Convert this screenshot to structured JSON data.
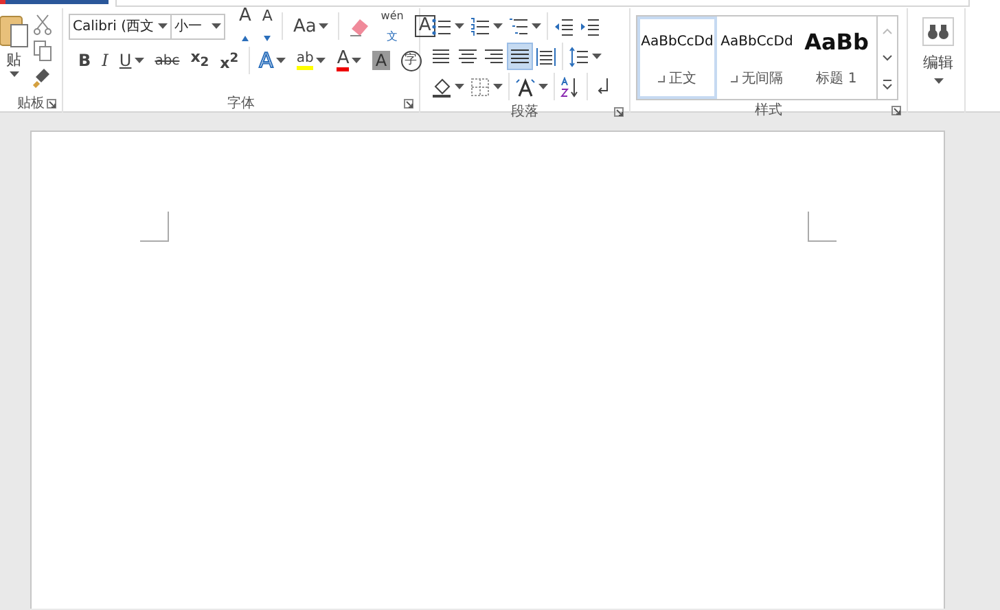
{
  "clipboard": {
    "paste_label": "贴",
    "group_label": "贴板",
    "launcher": true
  },
  "font": {
    "font_name": "Calibri (西文",
    "font_size": "小一",
    "group_label": "字体",
    "launcher": true,
    "row1": [
      [
        {
          "kind": "grow",
          "label": "A",
          "dropdown": false
        },
        {
          "kind": "shrink",
          "label": "A",
          "dropdown": false
        }
      ],
      [
        {
          "kind": "case",
          "label": "Aa",
          "dropdown": true
        }
      ],
      [
        {
          "kind": "eraser",
          "dropdown": false
        },
        {
          "kind": "phonetic",
          "label": "wén",
          "sub": "文",
          "dropdown": false
        },
        {
          "kind": "boxed",
          "label": "A",
          "dropdown": false
        }
      ]
    ],
    "row2": [
      [
        {
          "kind": "bold",
          "label": "B",
          "dropdown": false
        },
        {
          "kind": "italic",
          "label": "I",
          "dropdown": false
        },
        {
          "kind": "underline",
          "label": "U",
          "dropdown": true
        },
        {
          "kind": "strike",
          "label": "abc",
          "dropdown": false
        },
        {
          "kind": "sub",
          "label": "x$_{2}$",
          "dropdown": false
        },
        {
          "kind": "sup",
          "label": "x$^{2}$",
          "dropdown": false
        }
      ],
      [
        {
          "kind": "effect",
          "label": "A",
          "dropdown": true
        },
        {
          "kind": "highlight",
          "label": "ab",
          "dropdown": true
        },
        {
          "kind": "color",
          "label": "A",
          "dropdown": true
        },
        {
          "kind": "shaded",
          "label": "A",
          "dropdown": false
        },
        {
          "kind": "enclosed",
          "label": "字",
          "dropdown": false
        }
      ]
    ]
  },
  "paragraph": {
    "group_label": "段落",
    "launcher": true,
    "rows": [
      [
        [
          {
            "kind": "bullets",
            "dropdown": true,
            "selected": false
          },
          {
            "kind": "numbering",
            "dropdown": true,
            "selected": false
          },
          {
            "kind": "multilevel",
            "dropdown": true,
            "selected": false
          }
        ],
        [
          {
            "kind": "outdent",
            "dropdown": false,
            "selected": false
          },
          {
            "kind": "indent",
            "dropdown": false,
            "selected": false
          }
        ]
      ],
      [
        [
          {
            "kind": "align-left",
            "dropdown": false,
            "selected": false
          },
          {
            "kind": "align-center",
            "dropdown": false,
            "selected": false
          },
          {
            "kind": "align-right",
            "dropdown": false,
            "selected": false
          },
          {
            "kind": "justify",
            "dropdown": false,
            "selected": true
          },
          {
            "kind": "distributed",
            "dropdown": false,
            "selected": false
          }
        ],
        [
          {
            "kind": "line-spacing",
            "dropdown": true,
            "selected": false
          }
        ]
      ],
      [
        [
          {
            "kind": "shading",
            "dropdown": true,
            "selected": false
          },
          {
            "kind": "borders",
            "dropdown": true,
            "selected": false
          }
        ],
        [
          {
            "kind": "asian-layout",
            "dropdown": true,
            "selected": false
          }
        ],
        [
          {
            "kind": "sort",
            "dropdown": false,
            "selected": false
          }
        ],
        [
          {
            "kind": "show-marks",
            "dropdown": false,
            "selected": false
          }
        ]
      ]
    ]
  },
  "styles": {
    "group_label": "样式",
    "launcher": true,
    "items": [
      {
        "preview": "AaBbCcDd",
        "name": "正文",
        "kind": "normal",
        "mark": true,
        "selected": true
      },
      {
        "preview": "AaBbCcDd",
        "name": "无间隔",
        "kind": "normal",
        "mark": true,
        "selected": false
      },
      {
        "preview": "AaBb",
        "name": "标题 1",
        "kind": "heading",
        "mark": false,
        "selected": false
      }
    ]
  },
  "editing": {
    "label": "编辑"
  }
}
